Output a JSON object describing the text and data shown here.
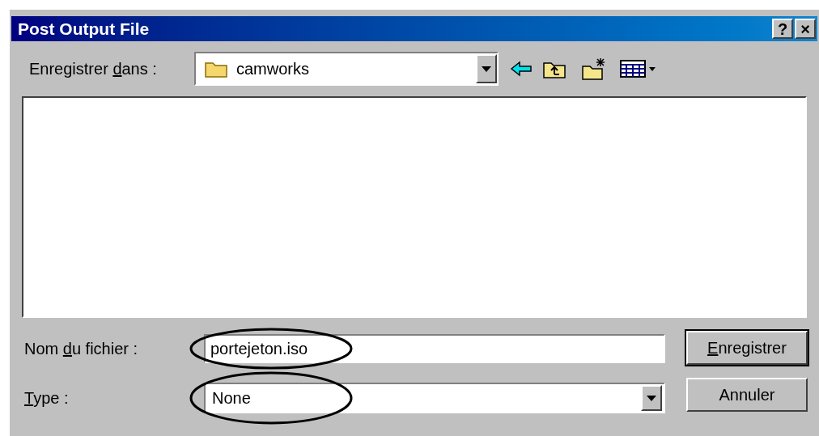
{
  "window": {
    "title": "Post Output File",
    "title_buttons": [
      "?",
      "×"
    ]
  },
  "save_in": {
    "label": {
      "before": "Enregistrer ",
      "key": "d",
      "after": "ans :"
    },
    "value": "camworks"
  },
  "file_name": {
    "label": {
      "before": "Nom ",
      "key": "d",
      "after": "u fichier :"
    },
    "value": "portejeton.iso",
    "highlighted": true
  },
  "file_type": {
    "label": {
      "key": "T",
      "after": "ype :"
    },
    "value": "None",
    "highlighted": true
  },
  "buttons": [
    {
      "key": "E",
      "after": "nregistrer",
      "default": true
    },
    {
      "after": "Annuler",
      "default": false
    }
  ]
}
